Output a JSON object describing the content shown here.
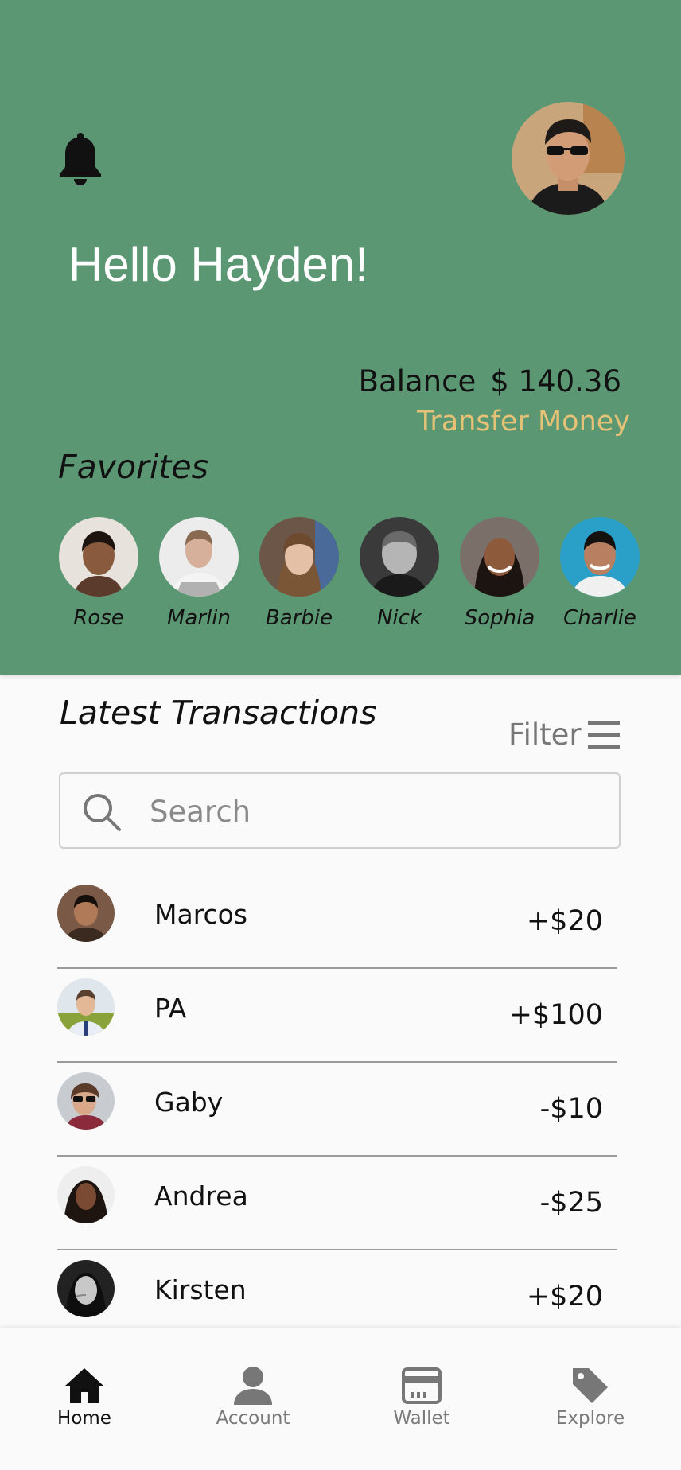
{
  "header": {
    "greeting": "Hello Hayden!",
    "balance_label": "Balance",
    "balance_value": "$ 140.36",
    "transfer_label": "Transfer Money",
    "bg_color": "#5b9773",
    "accent_color": "#e6c277"
  },
  "favorites": {
    "title": "Favorites",
    "items": [
      {
        "name": "Rose"
      },
      {
        "name": "Marlin"
      },
      {
        "name": "Barbie"
      },
      {
        "name": "Nick"
      },
      {
        "name": "Sophia"
      },
      {
        "name": "Charlie"
      }
    ]
  },
  "transactions": {
    "title": "Latest Transactions",
    "filter_label": "Filter",
    "search_placeholder": "Search",
    "items": [
      {
        "name": "Marcos",
        "amount": "+$20"
      },
      {
        "name": "PA",
        "amount": "+$100"
      },
      {
        "name": "Gaby",
        "amount": "-$10"
      },
      {
        "name": "Andrea",
        "amount": "-$25"
      },
      {
        "name": "Kirsten",
        "amount": "+$20"
      }
    ]
  },
  "tabbar": {
    "items": [
      {
        "label": "Home",
        "icon": "home-icon",
        "active": true
      },
      {
        "label": "Account",
        "icon": "account-icon",
        "active": false
      },
      {
        "label": "Wallet",
        "icon": "wallet-icon",
        "active": false
      },
      {
        "label": "Explore",
        "icon": "tag-icon",
        "active": false
      }
    ]
  }
}
